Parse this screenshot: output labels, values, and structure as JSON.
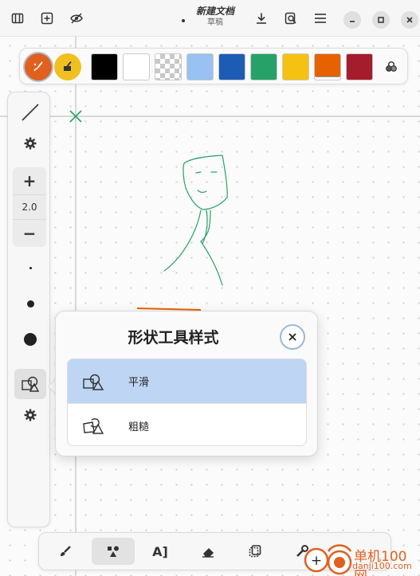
{
  "header": {
    "title": "新建文档",
    "subtitle": "草稿",
    "icons": [
      "sidebar-toggle-icon",
      "new-page-icon",
      "hide-icon",
      "download-icon",
      "open-icon",
      "menu-icon",
      "minimize-icon",
      "maximize-icon",
      "close-icon"
    ]
  },
  "colorbar": {
    "tools": [
      "pen-color-icon",
      "fill-color-icon"
    ],
    "active_tool_color": "#e0601f",
    "fill_tool_color": "#f0c020",
    "swatches": [
      {
        "name": "black",
        "color": "#000000"
      },
      {
        "name": "white",
        "color": "#ffffff"
      },
      {
        "name": "transparent",
        "color": "transparent"
      },
      {
        "name": "light-blue",
        "color": "#99c1f1"
      },
      {
        "name": "blue",
        "color": "#1c5cb5"
      },
      {
        "name": "green",
        "color": "#26a269"
      },
      {
        "name": "yellow",
        "color": "#f5c211"
      },
      {
        "name": "orange",
        "color": "#e66100"
      },
      {
        "name": "red",
        "color": "#a51d2d"
      }
    ],
    "selected_swatch": "orange",
    "more_colors_icon": "palette-icon"
  },
  "sidebar": {
    "line_tool_icon": "line-icon",
    "settings_icon": "gear-icon",
    "size": {
      "increase": "+",
      "value": "2.0",
      "decrease": "−"
    },
    "size_presets": [
      "small",
      "medium",
      "large"
    ],
    "shape_tool_icon": "shapes-icon",
    "shape_settings_icon": "gear-icon"
  },
  "popover": {
    "title": "形状工具样式",
    "close_icon": "close-icon",
    "options": [
      {
        "label": "平滑",
        "icon": "smooth-shapes-icon",
        "selected": true
      },
      {
        "label": "粗糙",
        "icon": "rough-shapes-icon",
        "selected": false
      }
    ]
  },
  "bottombar": {
    "tools": [
      {
        "name": "brush-tool",
        "icon": "brush-icon",
        "active": false
      },
      {
        "name": "shape-tool",
        "icon": "shapes-tool-icon",
        "active": true
      },
      {
        "name": "text-tool",
        "label": "A]",
        "active": false
      },
      {
        "name": "eraser-tool",
        "icon": "eraser-icon",
        "active": false
      },
      {
        "name": "selector-tool",
        "icon": "selector-icon",
        "active": false
      },
      {
        "name": "tools-tool",
        "icon": "wrench-icon",
        "active": false
      }
    ]
  },
  "watermark": {
    "line1": "单机100网",
    "line2": "danji100.com"
  },
  "colors": {
    "stroke_green": "#26a269",
    "stroke_orange": "#e66100",
    "selection_blue": "#bed6f3"
  }
}
